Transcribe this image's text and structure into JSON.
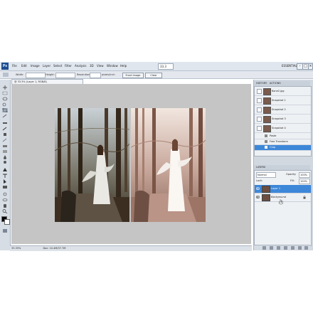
{
  "app": {
    "logo": "Ps",
    "menus": [
      "File",
      "Edit",
      "Image",
      "Layer",
      "Select",
      "Filter",
      "Analysis",
      "3D",
      "View",
      "Window",
      "Help"
    ],
    "zoom": "33.3",
    "workspace": "ESSENTIALS",
    "window_buttons": [
      "-",
      "□",
      "×"
    ]
  },
  "options_bar": {
    "width_label": "Width:",
    "height_label": "Height:",
    "resolution_label": "Resolution:",
    "resolution_unit": "pixels/inch",
    "front_image_label": "Front Image",
    "clear_label": "Clear"
  },
  "document": {
    "tab_title": "@ 33.3% (Layer 1, RGB/8)",
    "zoom_status": "33.33%",
    "doc_status": "Doc: 10.4M/37.7M"
  },
  "history": {
    "tabs": [
      "HISTORY",
      "ACTIONS"
    ],
    "snapshots": [
      {
        "label": "6one2.jpg"
      },
      {
        "label": "Snapshot 1"
      },
      {
        "label": "Snapshot 2"
      },
      {
        "label": "Snapshot 3"
      },
      {
        "label": "Snapshot 4"
      }
    ],
    "states": [
      {
        "label": "Paste"
      },
      {
        "label": "Free Transform"
      },
      {
        "label": "Crop"
      }
    ]
  },
  "layers": {
    "tabs": [
      "LAYERS"
    ],
    "blend_mode": "Normal",
    "opacity_label": "Opacity:",
    "opacity_value": "100%",
    "lock_label": "Lock:",
    "fill_label": "Fill:",
    "fill_value": "100%",
    "items": [
      {
        "name": "Layer 1",
        "selected": true
      },
      {
        "name": "Background",
        "selected": false
      }
    ]
  },
  "colors": {
    "menubar": "#dfe6ee",
    "canvas_bg": "#c5c5c5",
    "selection": "#3d87d9"
  }
}
